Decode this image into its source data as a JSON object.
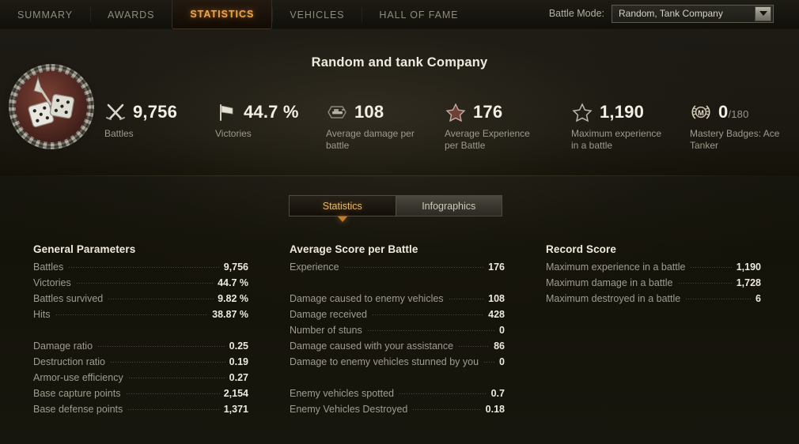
{
  "nav": {
    "tabs": [
      {
        "label": "SUMMARY",
        "active": false
      },
      {
        "label": "AWARDS",
        "active": false
      },
      {
        "label": "STATISTICS",
        "active": true
      },
      {
        "label": "VEHICLES",
        "active": false
      },
      {
        "label": "HALL OF FAME",
        "active": false
      }
    ]
  },
  "battle_mode": {
    "label": "Battle Mode:",
    "value": "Random, Tank Company",
    "icon": "chevron-down-icon"
  },
  "hero": {
    "title": "Random and tank Company",
    "emblem_icon": "dice-medal-emblem",
    "stats": [
      {
        "icon": "crossed-swords-icon",
        "value": "9,756",
        "suffix": "",
        "label": "Battles"
      },
      {
        "icon": "flag-icon",
        "value": "44.7 %",
        "suffix": "",
        "label": "Victories"
      },
      {
        "icon": "tank-damage-icon",
        "value": "108",
        "suffix": "",
        "label": "Average damage per battle"
      },
      {
        "icon": "star-filled-icon",
        "value": "176",
        "suffix": "",
        "label": "Average Experience per Battle"
      },
      {
        "icon": "star-outline-icon",
        "value": "1,190",
        "suffix": "",
        "label": "Maximum experience in a battle"
      },
      {
        "icon": "mastery-wreath-icon",
        "value": "0",
        "suffix": "/180",
        "label": "Mastery Badges: Ace Tanker"
      }
    ]
  },
  "subtabs": [
    {
      "label": "Statistics",
      "active": true
    },
    {
      "label": "Infographics",
      "active": false
    }
  ],
  "columns": [
    {
      "title": "General Parameters",
      "groups": [
        [
          {
            "label": "Battles",
            "value": "9,756"
          },
          {
            "label": "Victories",
            "value": "44.7 %"
          },
          {
            "label": "Battles survived",
            "value": "9.82 %"
          },
          {
            "label": "Hits",
            "value": "38.87 %"
          }
        ],
        [
          {
            "label": "Damage ratio",
            "value": "0.25"
          },
          {
            "label": "Destruction ratio",
            "value": "0.19"
          },
          {
            "label": "Armor-use efficiency",
            "value": "0.27"
          },
          {
            "label": "Base capture points",
            "value": "2,154"
          },
          {
            "label": "Base defense points",
            "value": "1,371"
          }
        ]
      ]
    },
    {
      "title": "Average Score per Battle",
      "groups": [
        [
          {
            "label": "Experience",
            "value": "176"
          }
        ],
        [
          {
            "label": "Damage caused to enemy vehicles",
            "value": "108"
          },
          {
            "label": "Damage received",
            "value": "428"
          },
          {
            "label": "Number of stuns",
            "value": "0"
          },
          {
            "label": "Damage caused with your assistance",
            "value": "86"
          },
          {
            "label": "Damage to enemy vehicles stunned by you",
            "value": "0"
          }
        ],
        [
          {
            "label": "Enemy vehicles spotted",
            "value": "0.7"
          },
          {
            "label": "Enemy Vehicles Destroyed",
            "value": "0.18"
          }
        ]
      ]
    },
    {
      "title": "Record Score",
      "groups": [
        [
          {
            "label": "Maximum experience in a battle",
            "value": "1,190"
          },
          {
            "label": "Maximum damage in a battle",
            "value": "1,728"
          },
          {
            "label": "Maximum destroyed in a battle",
            "value": "6"
          }
        ]
      ]
    }
  ],
  "colors": {
    "accent": "#f2a24a",
    "value_text": "#eeeade",
    "label_text": "#a09c8f",
    "background": "#17160f"
  }
}
